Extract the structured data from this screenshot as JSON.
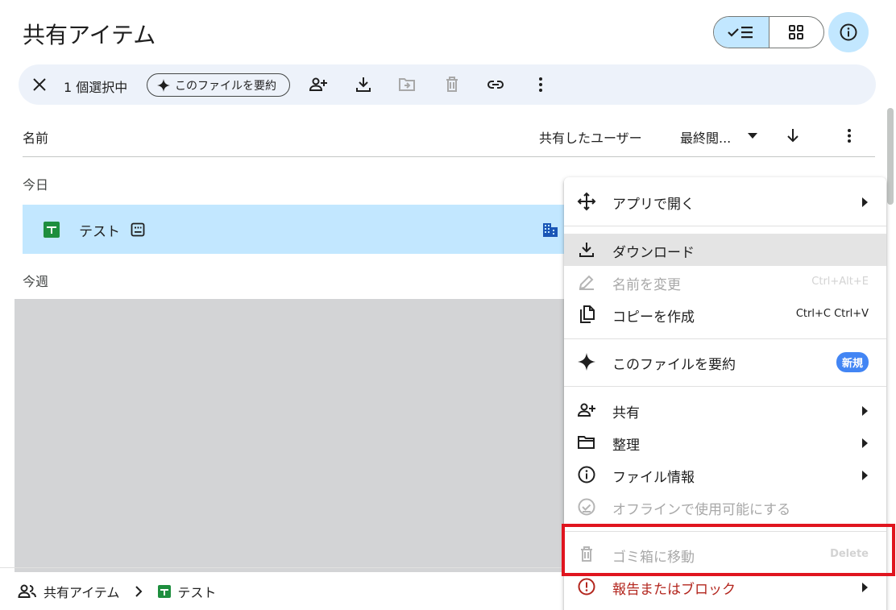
{
  "page": {
    "title": "共有アイテム"
  },
  "selection_bar": {
    "count_label": "1 個選択中",
    "summarize_label": "このファイルを要約"
  },
  "columns": {
    "name": "名前",
    "shared_by": "共有したユーザー",
    "last_modified": "最終閲..."
  },
  "sections": {
    "today": "今日",
    "this_week": "今週"
  },
  "file": {
    "name": "テスト"
  },
  "breadcrumb": {
    "root": "共有アイテム",
    "current": "テスト"
  },
  "context_menu": {
    "open_with": "アプリで開く",
    "download": "ダウンロード",
    "rename": "名前を変更",
    "rename_shortcut": "Ctrl+Alt+E",
    "make_copy": "コピーを作成",
    "make_copy_shortcut": "Ctrl+C Ctrl+V",
    "summarize": "このファイルを要約",
    "new_badge": "新規",
    "share": "共有",
    "organize": "整理",
    "file_info": "ファイル情報",
    "offline": "オフラインで使用可能にする",
    "trash": "ゴミ箱に移動",
    "trash_shortcut": "Delete",
    "report": "報告またはブロック"
  },
  "colors": {
    "accent_blue": "#c2e7ff",
    "danger_red": "#b3261e",
    "highlight_red": "#e0151f",
    "sheets_green": "#1e8e3e",
    "badge_blue": "#4285f4"
  }
}
